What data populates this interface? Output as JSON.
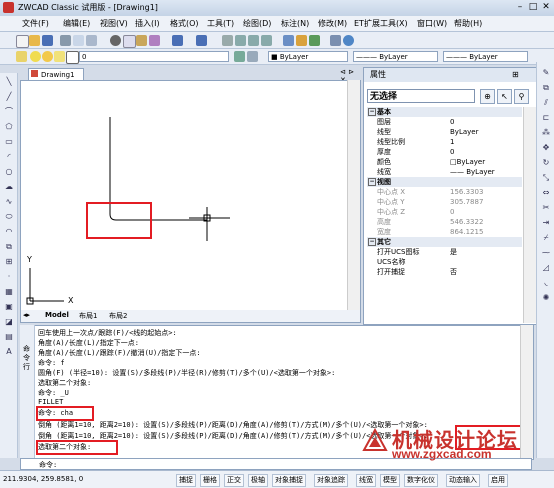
{
  "window": {
    "title": "ZWCAD Classic 试用版 - [Drawing1]",
    "min_btn": "–",
    "max_btn": "□",
    "close_btn": "✕"
  },
  "menu": [
    "文件(F)",
    "编辑(E)",
    "视图(V)",
    "插入(I)",
    "格式(O)",
    "工具(T)",
    "绘图(D)",
    "标注(N)",
    "修改(M)",
    "ET扩展工具(X)",
    "窗口(W)",
    "帮助(H)"
  ],
  "toolbar": {
    "layer_value": "0",
    "color_value": "■ ByLayer",
    "linetype_value": "——— ByLayer",
    "lineweight_value": "——— ByLayer"
  },
  "drawing": {
    "tab_label": "Drawing1",
    "layout_tabs": [
      "Model",
      "布局1",
      "布局2"
    ],
    "ucs_x": "X",
    "ucs_y": "Y"
  },
  "properties": {
    "header": "属性",
    "selection": "无选择",
    "sections": [
      {
        "title": "基本",
        "rows": [
          {
            "k": "图层",
            "v": "0"
          },
          {
            "k": "线型",
            "v": "ByLayer"
          },
          {
            "k": "线型比例",
            "v": "1"
          },
          {
            "k": "厚度",
            "v": "0"
          },
          {
            "k": "颜色",
            "v": "□ByLayer"
          },
          {
            "k": "线宽",
            "v": "—— ByLayer"
          }
        ]
      },
      {
        "title": "视图",
        "rows": [
          {
            "k": "中心点 X",
            "v": "156.3303",
            "gray": true
          },
          {
            "k": "中心点 Y",
            "v": "305.7887",
            "gray": true
          },
          {
            "k": "中心点 Z",
            "v": "0",
            "gray": true
          },
          {
            "k": "高度",
            "v": "546.3322",
            "gray": true
          },
          {
            "k": "宽度",
            "v": "864.1215",
            "gray": true
          }
        ]
      },
      {
        "title": "其它",
        "rows": [
          {
            "k": "打开UCS图标",
            "v": "是"
          },
          {
            "k": "UCS名称",
            "v": ""
          },
          {
            "k": "打开捕捉",
            "v": "否"
          }
        ]
      }
    ]
  },
  "command": {
    "side_label": "命令行",
    "lines": [
      "回车使用上一次点/跟踪(F)/<线的起始点>:",
      "角度(A)/长度(L)/指定下一点:",
      "角度(A)/长度(L)/跟踪(F)/撤消(U)/指定下一点:",
      "命令: f",
      "圆角(F) (半径=10):  设置(S)/多段线(P)/半径(R)/修剪(T)/多个(U)/<选取第一个对象>:",
      "选取第二个对象:",
      "命令: _U",
      "FILLET",
      "命令: cha",
      "倒角 (距离1=10, 距离2=10):  设置(S)/多段线(P)/距离(D)/角度(A)/修剪(T)/方式(M)/多个(U)/<选取第一个对象>:",
      "倒角 (距离1=10, 距离2=10):  设置(S)/多段线(P)/距离(D)/角度(A)/修剪(T)/方式(M)/多个(U)/<选取第一个对象>:",
      "选取第二个对象:",
      "",
      "命令:"
    ]
  },
  "status": {
    "coords": "211.9304, 259.8581, 0",
    "buttons": [
      "捕捉",
      "栅格",
      "正交",
      "极轴",
      "对象捕捉",
      "对象追踪",
      "线宽",
      "模型",
      "数字化仪",
      "动态输入",
      "启用"
    ]
  },
  "watermark": {
    "text": "机械设计论坛",
    "url": "www.zgxcad.com"
  }
}
